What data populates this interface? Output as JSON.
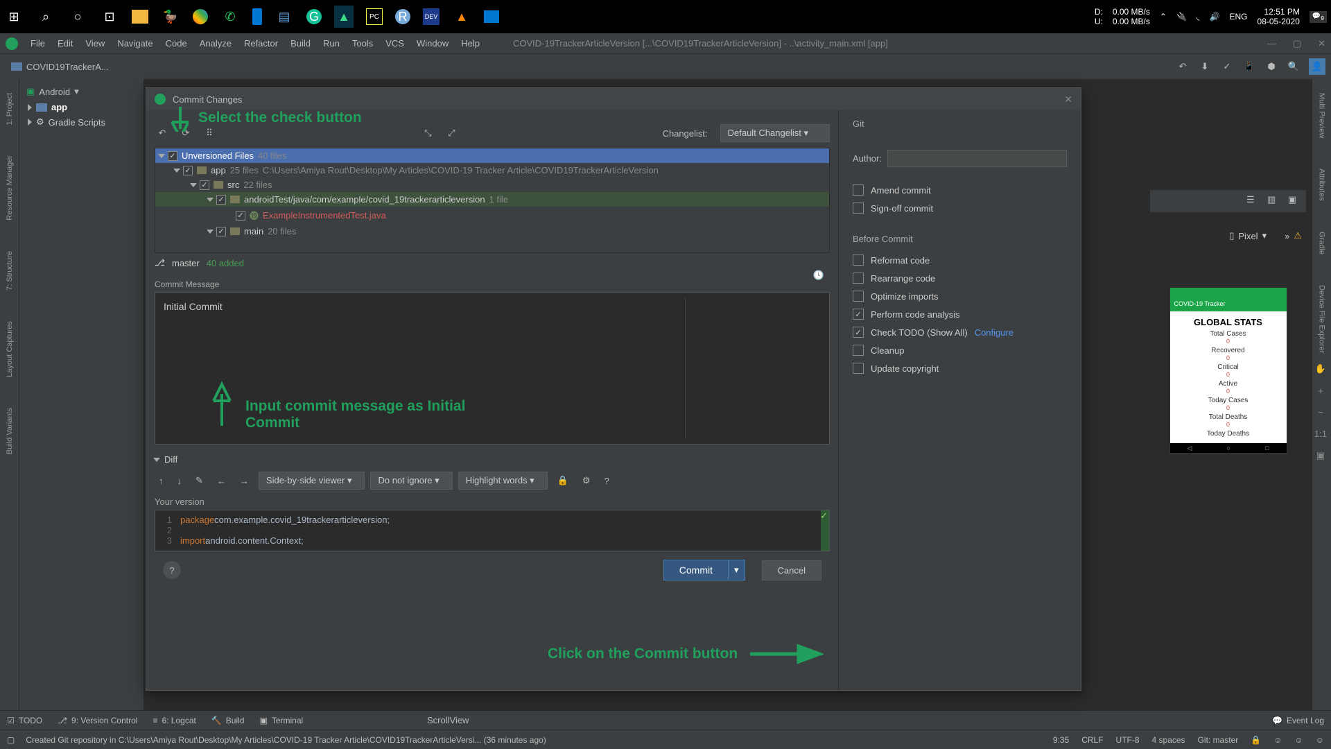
{
  "taskbar": {
    "drive_d": "D:",
    "drive_u": "U:",
    "net_up": "0.00 MB/s",
    "net_down": "0.00 MB/s",
    "lang": "ENG",
    "time": "12:51 PM",
    "date": "08-05-2020",
    "notif_count": "9"
  },
  "menubar": [
    "File",
    "Edit",
    "View",
    "Navigate",
    "Code",
    "Analyze",
    "Refactor",
    "Build",
    "Run",
    "Tools",
    "VCS",
    "Window",
    "Help"
  ],
  "project_title": "COVID-19TrackerArticleVersion [...\\COVID19TrackerArticleVersion] - ..\\activity_main.xml [app]",
  "breadcrumb": "COVID19TrackerA...",
  "left_tabs": [
    "1: Project",
    "Resource Manager",
    "7: Structure",
    "Layout Captures",
    "Build Variants"
  ],
  "right_tabs": [
    "Multi Preview",
    "Attributes",
    "Gradle",
    "Device File Explorer"
  ],
  "project_tree": {
    "header": "Android",
    "items": [
      "app",
      "Gradle Scripts"
    ]
  },
  "dialog": {
    "title": "Commit Changes",
    "changelist_label": "Changelist:",
    "changelist_value": "Default Changelist",
    "files": {
      "unversioned": {
        "label": "Unversioned Files",
        "count": "40 files"
      },
      "app": {
        "label": "app",
        "count": "25 files",
        "path": "C:\\Users\\Amiya Rout\\Desktop\\My Articles\\COVID-19 Tracker Article\\COVID19TrackerArticleVersion"
      },
      "src": {
        "label": "src",
        "count": "22 files"
      },
      "androidTest": {
        "label": "androidTest/java/com/example/covid_19trackerarticleversion",
        "count": "1 file"
      },
      "example_file": "ExampleInstrumentedTest.java",
      "main": {
        "label": "main",
        "count": "20 files"
      }
    },
    "branch": "master",
    "added": "40 added",
    "commit_msg_label": "Commit Message",
    "commit_msg": "Initial Commit",
    "diff_label": "Diff",
    "diff_viewer": "Side-by-side viewer",
    "diff_ignore": "Do not ignore",
    "diff_highlight": "Highlight words",
    "your_version": "Your version",
    "code": {
      "line1a": "package ",
      "line1b": "com.example.covid_19trackerarticleversion;",
      "line3a": "import ",
      "line3b": "android.content.Context;"
    },
    "commit_btn": "Commit",
    "cancel_btn": "Cancel",
    "git_header": "Git",
    "author_label": "Author:",
    "amend": "Amend commit",
    "signoff": "Sign-off commit",
    "before_commit": "Before Commit",
    "opts": {
      "reformat": "Reformat code",
      "rearrange": "Rearrange code",
      "optimize": "Optimize imports",
      "analysis": "Perform code analysis",
      "todo": "Check TODO (Show All)",
      "configure": "Configure",
      "cleanup": "Cleanup",
      "copyright": "Update copyright"
    }
  },
  "annotations": {
    "check": "Select the check button",
    "msg": "Input commit message as Initial Commit",
    "commit": "Click on the Commit button"
  },
  "preview": {
    "device": "Pixel",
    "app_title": "COVID-19 Tracker",
    "global": "GLOBAL STATS",
    "stats": [
      "Total Cases",
      "Recovered",
      "Critical",
      "Active",
      "Today Cases",
      "Total Deaths",
      "Today Deaths"
    ],
    "zero": "0",
    "zoom": "1:1"
  },
  "bottom_tabs": {
    "todo": "TODO",
    "vcs": "9: Version Control",
    "logcat": "6: Logcat",
    "build": "Build",
    "terminal": "Terminal",
    "eventlog": "Event Log",
    "scrollview": "ScrollView"
  },
  "status": {
    "msg": "Created Git repository in C:\\Users\\Amiya Rout\\Desktop\\My Articles\\COVID-19 Tracker Article\\COVID19TrackerArticleVersi... (36 minutes ago)",
    "pos": "9:35",
    "enc": "CRLF",
    "charset": "UTF-8",
    "indent": "4 spaces",
    "git": "Git: master"
  }
}
